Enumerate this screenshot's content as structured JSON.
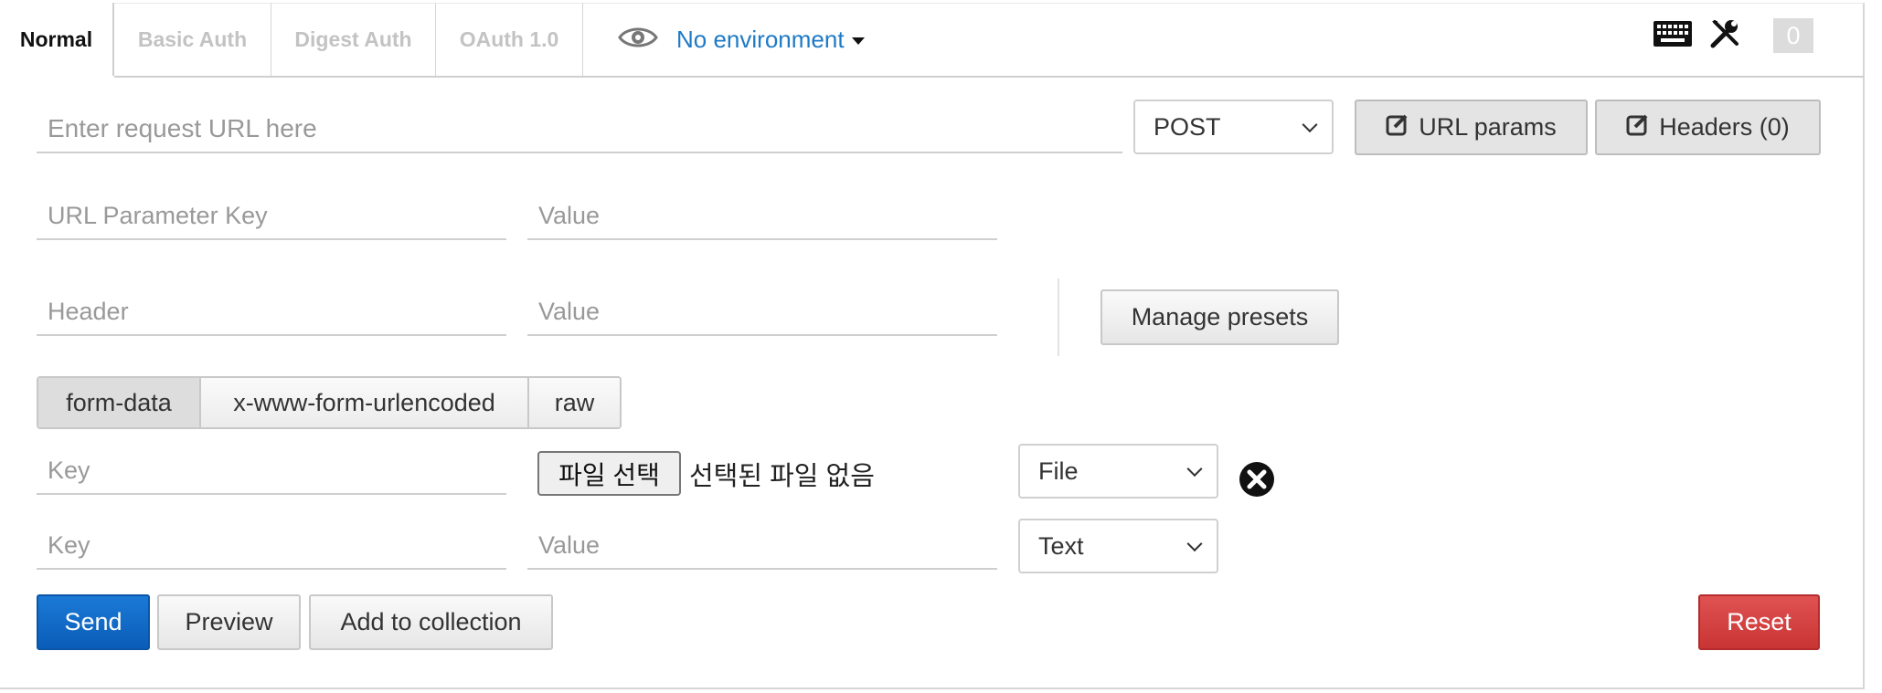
{
  "tabs": [
    {
      "label": "Normal",
      "active": true
    },
    {
      "label": "Basic Auth",
      "active": false
    },
    {
      "label": "Digest Auth",
      "active": false
    },
    {
      "label": "OAuth 1.0",
      "active": false
    }
  ],
  "environment": {
    "label": "No environment",
    "icon": "eye-icon"
  },
  "toolbar": {
    "keyboard_icon": "keyboard-icon",
    "settings_icon": "wrench-icon",
    "counter": "0"
  },
  "request": {
    "url_placeholder": "Enter request URL here",
    "method": "POST",
    "url_params_label": "URL params",
    "headers_label": "Headers (0)"
  },
  "params": {
    "key_placeholder": "URL Parameter Key",
    "value_placeholder": "Value"
  },
  "headers": {
    "key_placeholder": "Header",
    "value_placeholder": "Value",
    "manage_presets_label": "Manage presets"
  },
  "body_modes": [
    {
      "label": "form-data",
      "active": true
    },
    {
      "label": "x-www-form-urlencoded",
      "active": false
    },
    {
      "label": "raw",
      "active": false
    }
  ],
  "form_rows": [
    {
      "key_placeholder": "Key",
      "file_button": "파일 선택",
      "file_status": "선택된 파일 없음",
      "type": "File"
    },
    {
      "key_placeholder": "Key",
      "value_placeholder": "Value",
      "type": "Text"
    }
  ],
  "actions": {
    "send": "Send",
    "preview": "Preview",
    "add_to_collection": "Add to collection",
    "reset": "Reset"
  },
  "colors": {
    "accent": "#1e7ac6",
    "primary": "#0a5db8",
    "danger": "#c93434"
  }
}
